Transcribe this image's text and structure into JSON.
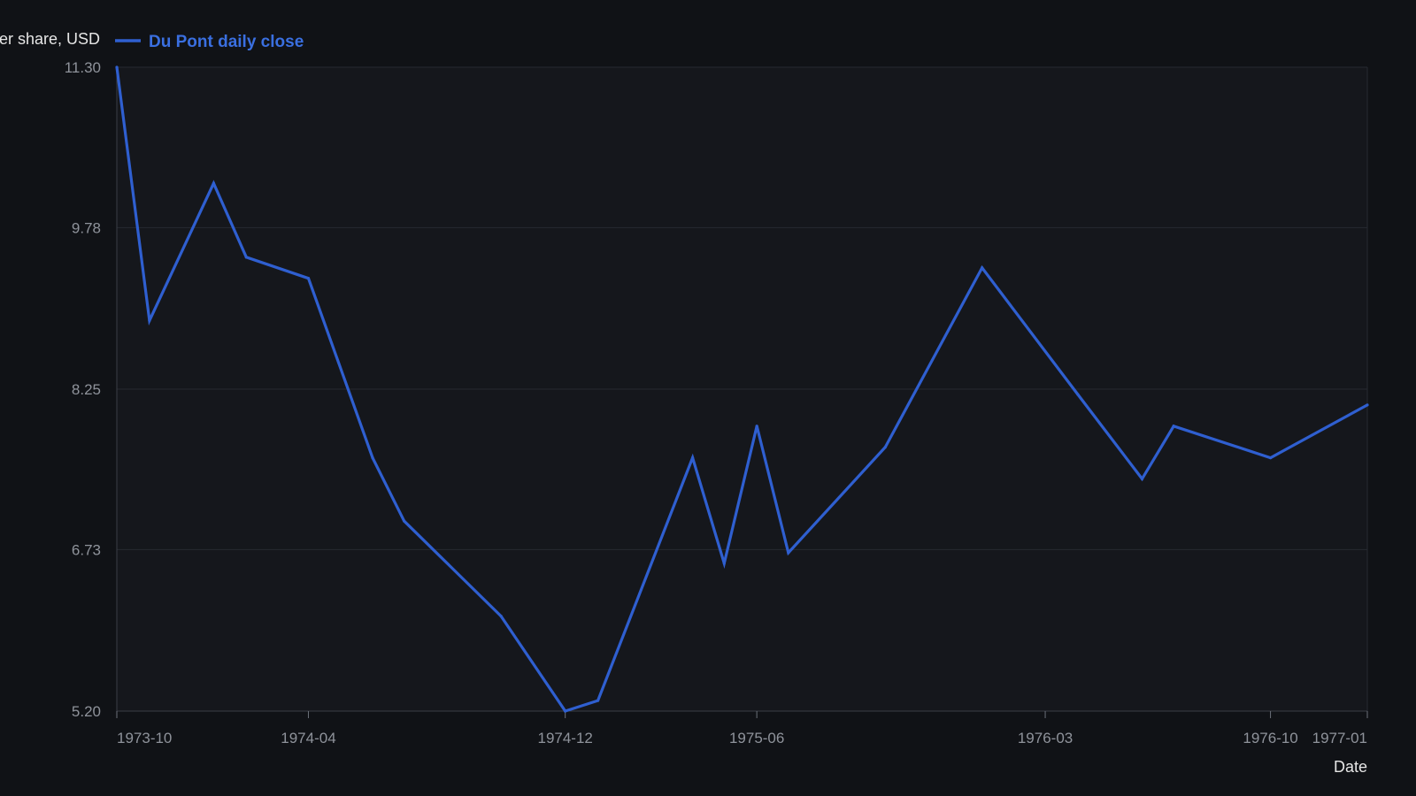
{
  "chart_data": {
    "type": "line",
    "title": "",
    "ylabel": "Price per share, USD",
    "xlabel": "Date",
    "ylim": [
      5.2,
      11.3
    ],
    "y_ticks": [
      "5.20",
      "6.73",
      "8.25",
      "9.78",
      "11.30"
    ],
    "xlim": [
      "1973-10-01",
      "1977-01-01"
    ],
    "x_ticks": [
      "1973-10",
      "1974-04",
      "1974-12",
      "1975-06",
      "1976-03",
      "1976-10",
      "1977-01"
    ],
    "grid": true,
    "legend_position": "top-left",
    "colors": {
      "background": "#101216",
      "plot_bg": "#15171c",
      "line": "#2f5fd0",
      "grid": "#262a31"
    },
    "series": [
      {
        "name": "Du Pont daily close",
        "x": [
          "1973-10-01",
          "1973-11-01",
          "1974-01-01",
          "1974-02-01",
          "1974-04-01",
          "1974-06-01",
          "1974-07-01",
          "1974-10-01",
          "1974-12-01",
          "1975-01-01",
          "1975-04-01",
          "1975-05-01",
          "1975-06-01",
          "1975-07-01",
          "1975-10-01",
          "1976-01-01",
          "1976-04-01",
          "1976-06-01",
          "1976-07-01",
          "1976-10-01",
          "1977-01-01"
        ],
        "values": [
          11.3,
          8.9,
          10.2,
          9.5,
          9.3,
          7.6,
          7.0,
          6.1,
          5.2,
          5.3,
          7.6,
          6.6,
          7.9,
          6.7,
          7.7,
          9.4,
          8.2,
          7.4,
          7.9,
          7.6,
          8.1
        ]
      }
    ]
  }
}
